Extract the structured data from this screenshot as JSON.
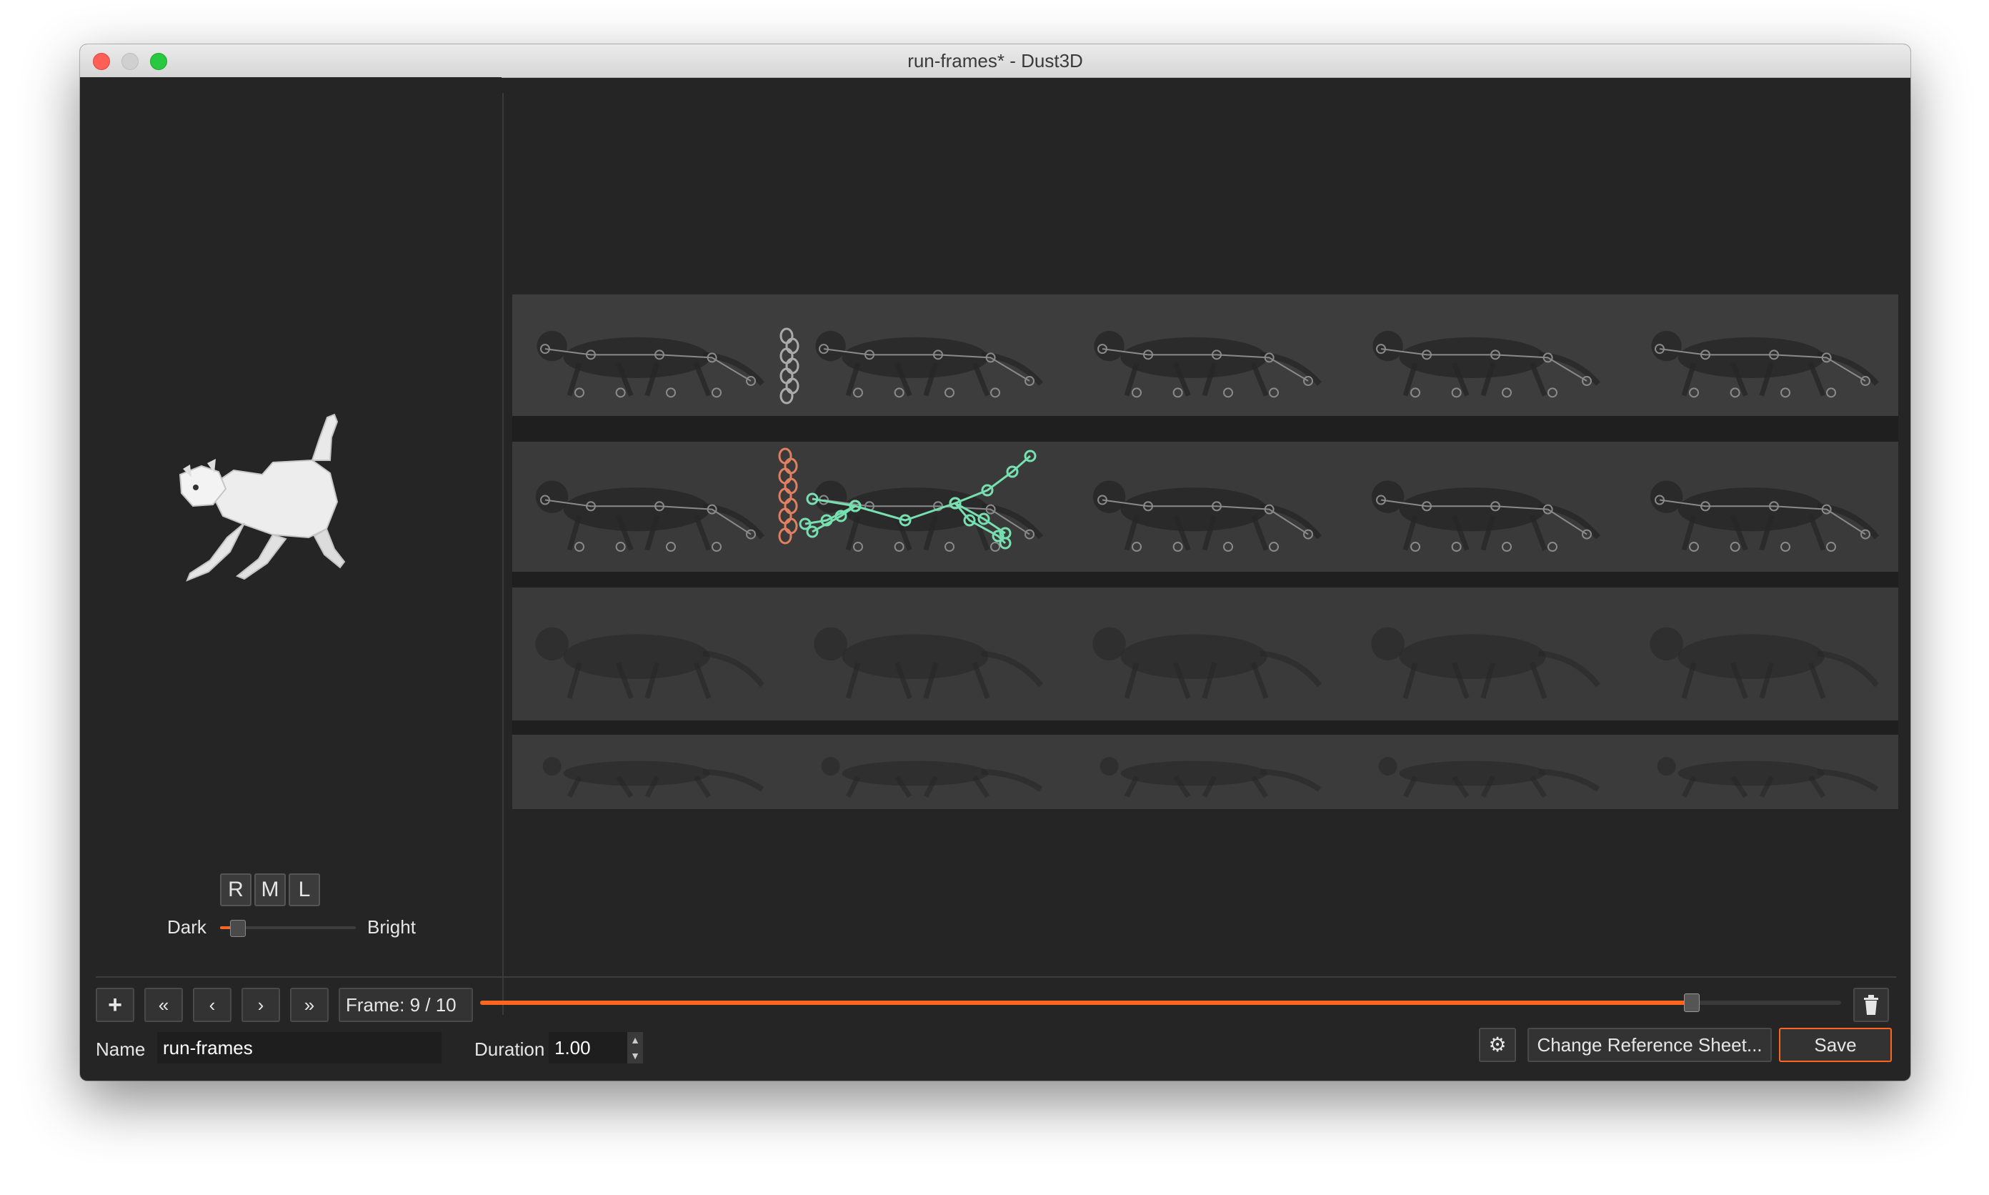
{
  "window": {
    "title": "run-frames* - Dust3D"
  },
  "preview": {
    "buttons": [
      "R",
      "M",
      "L"
    ],
    "light": {
      "dark_label": "Dark",
      "bright_label": "Bright",
      "value": 0.06
    }
  },
  "toolbar": {
    "add_icon": "plus-icon",
    "first_icon": "double-chevron-left-icon",
    "prev_icon": "chevron-left-icon",
    "next_icon": "chevron-right-icon",
    "last_icon": "double-chevron-right-icon",
    "frame_label": "Frame:  9 / 10",
    "frame_current": 9,
    "frame_total": 10,
    "timeline_progress": 0.89,
    "delete_icon": "trash-icon"
  },
  "properties": {
    "name_label": "Name",
    "name_value": "run-frames",
    "duration_label": "Duration",
    "duration_value": "1.00"
  },
  "actions": {
    "settings_icon": "gear-icon",
    "change_reference": "Change Reference Sheet...",
    "save": "Save"
  },
  "colors": {
    "accent": "#fc6621",
    "background": "#252525",
    "skeleton_selected": "#77e0b0",
    "skeleton_mirror": "#e08060"
  }
}
